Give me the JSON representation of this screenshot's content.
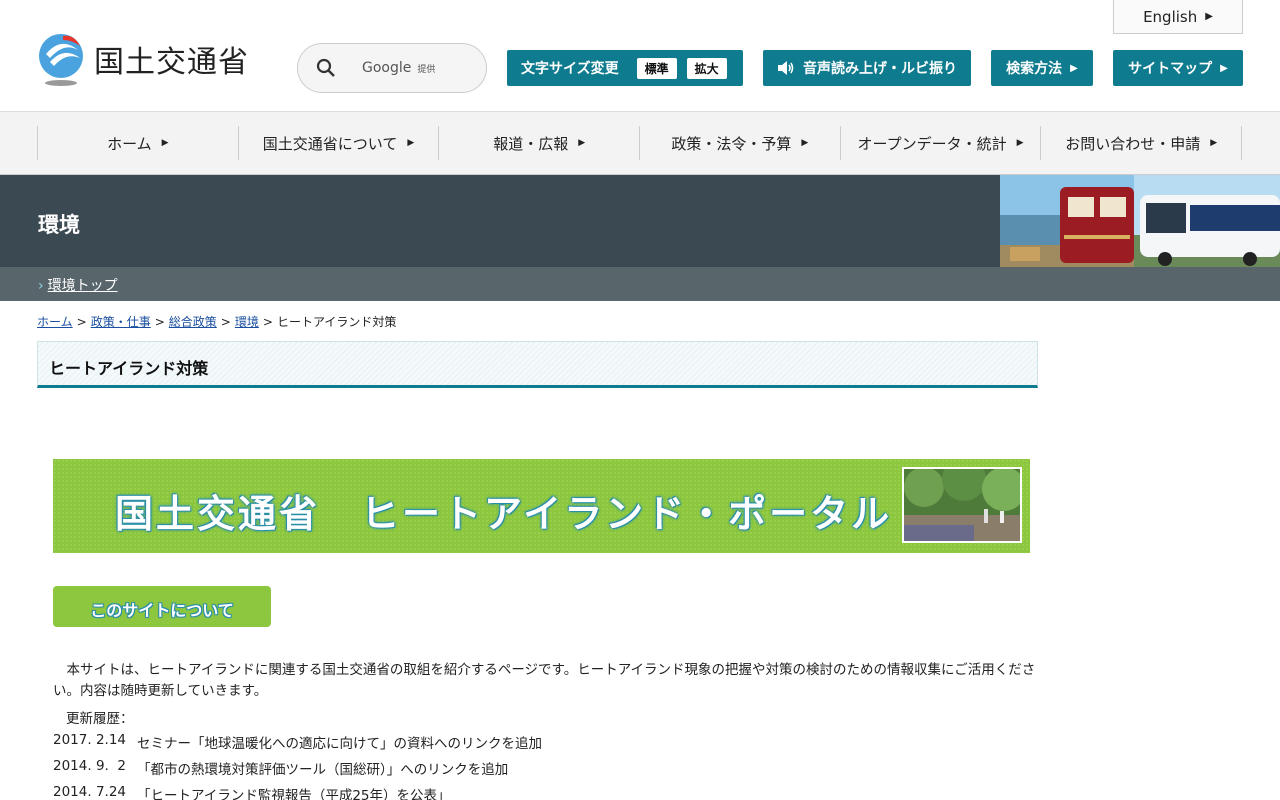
{
  "header": {
    "logo_text": "国土交通省",
    "english_label": "English",
    "search": {
      "provider": "Google",
      "provided": "提供"
    },
    "font_size": {
      "label": "文字サイズ変更",
      "options": [
        "標準",
        "拡大"
      ]
    },
    "voice_label": "音声読み上げ・ルビ振り",
    "search_method_label": "検索方法",
    "sitemap_label": "サイトマップ"
  },
  "gnav": {
    "items": [
      "ホーム",
      "国土交通省について",
      "報道・広報",
      "政策・法令・予算",
      "オープンデータ・統計",
      "お問い合わせ・申請"
    ]
  },
  "section": {
    "title": "環境",
    "sub_link": "環境トップ"
  },
  "breadcrumb": {
    "links": [
      "ホーム",
      "政策・仕事",
      "総合政策",
      "環境"
    ],
    "current": "ヒートアイランド対策"
  },
  "page": {
    "title": "ヒートアイランド対策",
    "portal_title": "国土交通省　ヒートアイランド・ポータル",
    "about_label": "このサイトについて",
    "intro": "　本サイトは、ヒートアイランドに関連する国土交通省の取組を紹介するページです。ヒートアイランド現象の把握や対策の検討のための情報収集にご活用ください。内容は随時更新していきます。",
    "history_label": "更新履歴：",
    "updates": [
      {
        "date": "2017. 2.14",
        "text": "セミナー「地球温暖化への適応に向けて」の資料へのリンクを追加"
      },
      {
        "date": "2014. 9.  2",
        "text": "「都市の熱環境対策評価ツール（国総研）」へのリンクを追加"
      },
      {
        "date": "2014. 7.24",
        "text": "「ヒートアイランド監視報告（平成25年）を公表」"
      }
    ]
  },
  "colors": {
    "accent": "#0f7b8f",
    "banner_dark": "#3b4a52",
    "subbar": "#58656b",
    "portal_green": "#8dc63f"
  }
}
